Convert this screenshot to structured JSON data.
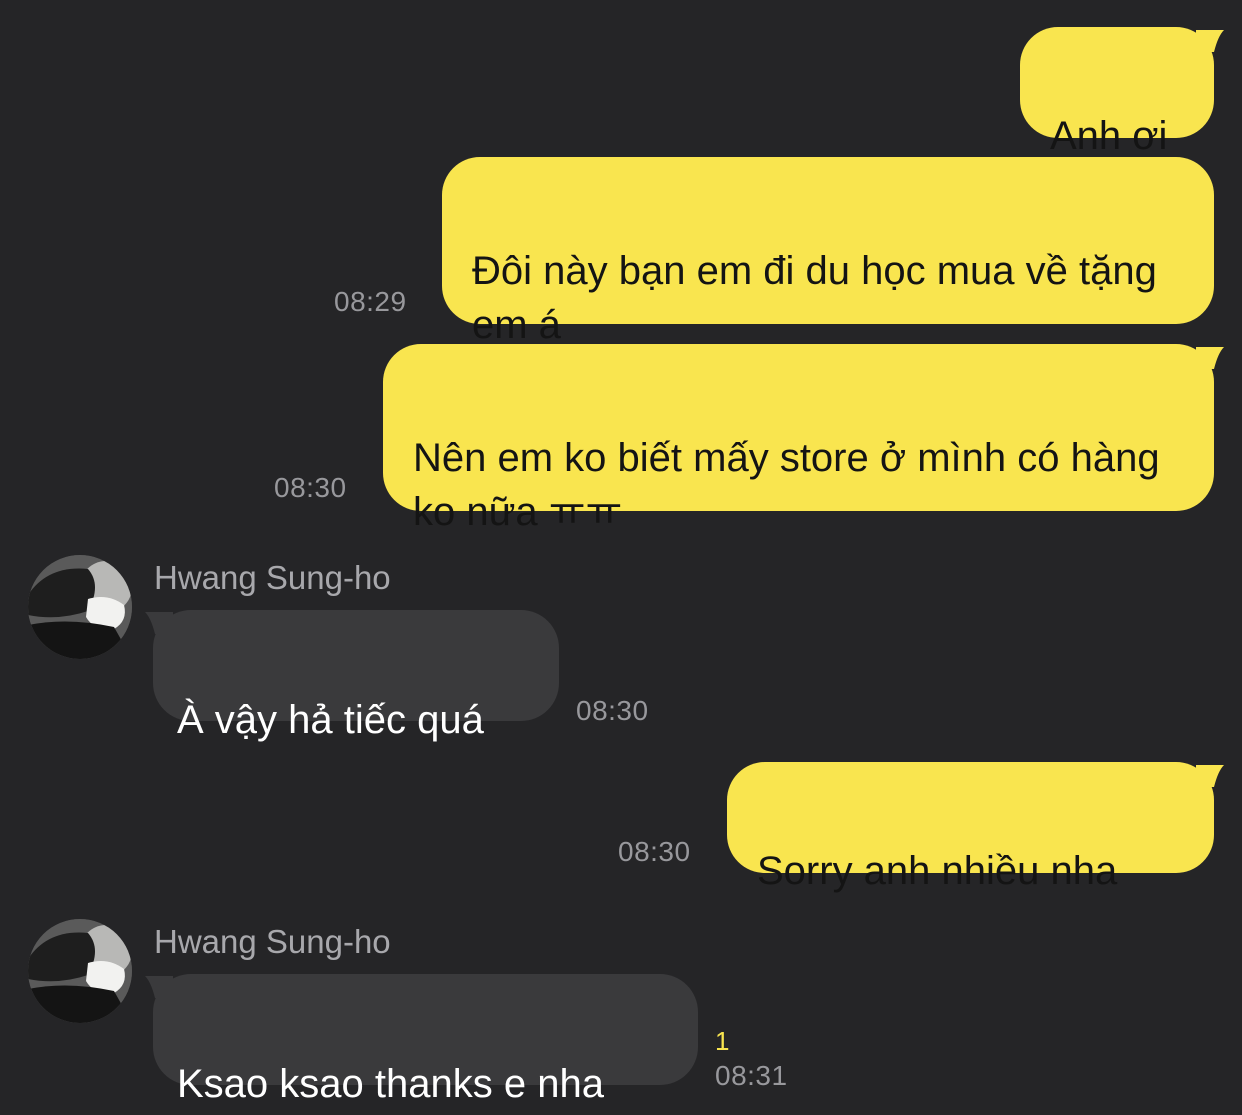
{
  "colors": {
    "background": "#252527",
    "outgoing_bubble": "#f9e54f",
    "incoming_bubble": "#3a3a3c",
    "timestamp": "#98989c",
    "unread_count": "#f9e54f"
  },
  "messages": [
    {
      "side": "outgoing",
      "text": "Anh ơi",
      "time": ""
    },
    {
      "side": "outgoing",
      "text": "Đôi này bạn em đi du học mua về tặng em á",
      "time": "08:29"
    },
    {
      "side": "outgoing",
      "text": "Nên em ko biết mấy store ở mình có hàng ko nữa ㅠㅠ",
      "time": "08:30"
    },
    {
      "side": "incoming",
      "sender": "Hwang Sung-ho",
      "avatar_icon": "profile-photo",
      "text": "À vậy hả tiếc quá",
      "time": "08:30"
    },
    {
      "side": "outgoing",
      "text": "Sorry anh nhiều nha",
      "time": "08:30"
    },
    {
      "side": "incoming",
      "sender": "Hwang Sung-ho",
      "avatar_icon": "profile-photo",
      "text": "Ksao ksao thanks e nha",
      "time": "08:31",
      "unread": "1"
    }
  ]
}
